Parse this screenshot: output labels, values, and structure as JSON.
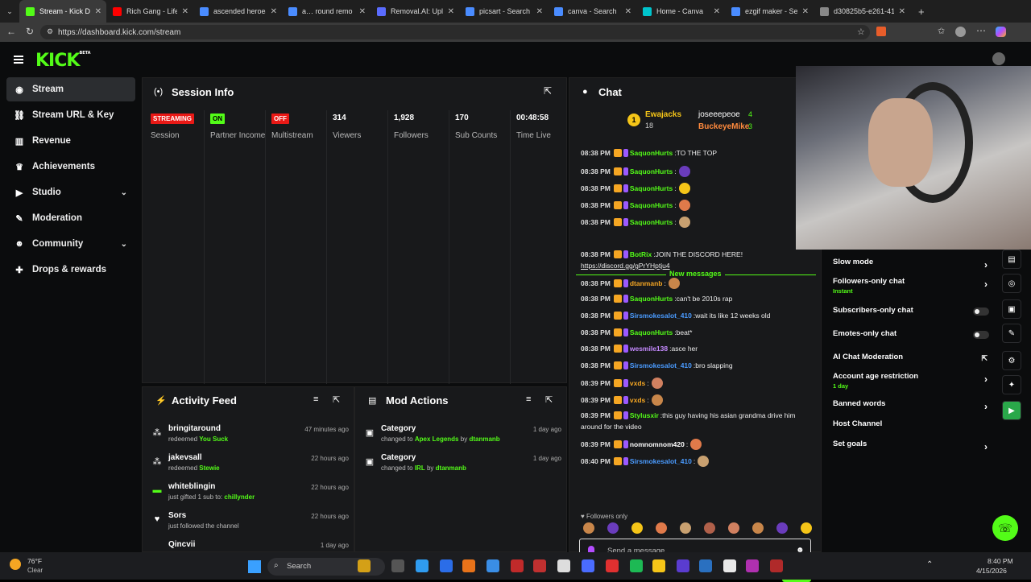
{
  "browser": {
    "tabs": [
      {
        "label": "Stream - Kick Dashb",
        "color": "#53fc18",
        "active": true
      },
      {
        "label": "Rich Gang - Life",
        "color": "#ff0000",
        "active": false
      },
      {
        "label": "ascended heroes log",
        "color": "#4a8cff",
        "active": false
      },
      {
        "label": "a… round remo",
        "color": "#4a8cff",
        "active": false
      },
      {
        "label": "Removal.AI: Upload",
        "color": "#5a6cff",
        "active": false
      },
      {
        "label": "picsart - Search",
        "color": "#4a8cff",
        "active": false
      },
      {
        "label": "canva - Search",
        "color": "#4a8cff",
        "active": false
      },
      {
        "label": "Home - Canva",
        "color": "#00c4cc",
        "active": false
      },
      {
        "label": "ezgif maker - Search",
        "color": "#4a8cff",
        "active": false
      },
      {
        "label": "d30825b5-e261-413",
        "color": "#888888",
        "active": false
      }
    ],
    "url": "https://dashboard.kick.com/stream",
    "new_tab": "+"
  },
  "app": {
    "logo": "KICK",
    "logo_tag": "BETA",
    "accent": "#53fc18"
  },
  "sidebar": {
    "items": [
      {
        "label": "Stream",
        "icon": "broadcast-icon"
      },
      {
        "label": "Stream URL & Key",
        "icon": "link-icon"
      },
      {
        "label": "Revenue",
        "icon": "chart-icon"
      },
      {
        "label": "Achievements",
        "icon": "trophy-icon"
      },
      {
        "label": "Studio",
        "icon": "video-icon"
      },
      {
        "label": "Moderation",
        "icon": "wrench-icon"
      },
      {
        "label": "Community",
        "icon": "users-icon"
      },
      {
        "label": "Drops & rewards",
        "icon": "gift-icon"
      }
    ]
  },
  "session": {
    "title": "Session Info",
    "stats": [
      {
        "badge": "STREAMING",
        "badge_color": "#e91916",
        "label": "Session"
      },
      {
        "badge": "ON",
        "badge_color": "#53fc18",
        "label": "Partner Income"
      },
      {
        "badge": "OFF",
        "badge_color": "#e91916",
        "label": "Multistream"
      },
      {
        "value": "314",
        "label": "Viewers"
      },
      {
        "value": "1,928",
        "label": "Followers"
      },
      {
        "value": "170",
        "label": "Sub Counts"
      },
      {
        "value": "00:48:58",
        "label": "Time Live"
      }
    ]
  },
  "activity": {
    "title": "Activity Feed",
    "items": [
      {
        "name": "bringitaround",
        "text": "redeemed",
        "highlight": "You Suck",
        "time": "47 minutes ago"
      },
      {
        "name": "jakevsall",
        "text": "redeemed",
        "highlight": "Stewie",
        "time": "22 hours ago"
      },
      {
        "name": "whiteblingin",
        "text": "just gifted 1 sub to:",
        "highlight": "chillynder",
        "time": "22 hours ago"
      },
      {
        "name": "Sors",
        "text": "just followed the channel",
        "highlight": "",
        "time": "22 hours ago"
      },
      {
        "name": "Qincvii",
        "text": "",
        "highlight": "",
        "time": "1 day ago"
      }
    ]
  },
  "mod_actions": {
    "title": "Mod Actions",
    "items": [
      {
        "name": "Category",
        "text": "changed to",
        "value": "Apex Legends",
        "by": "by",
        "mod": "dtanmanb",
        "time": "1 day ago"
      },
      {
        "name": "Category",
        "text": "changed to",
        "value": "IRL",
        "by": "by",
        "mod": "dtanmanb",
        "time": "1 day ago"
      }
    ]
  },
  "chat": {
    "title": "Chat",
    "top_gifters": [
      {
        "rank": "1",
        "name": "Ewajacks",
        "count": "18"
      },
      {
        "name": "joseeepeoe",
        "count": "4"
      },
      {
        "name": "BuckeyeMike",
        "count": "3"
      }
    ],
    "new_messages_label": "New messages",
    "messages": [
      {
        "time": "08:38 PM",
        "user": "SaquonHurts",
        "color": "#53fc18",
        "text": "TO THE TOP"
      },
      {
        "time": "08:38 PM",
        "user": "SaquonHurts",
        "color": "#53fc18",
        "text": ""
      },
      {
        "time": "08:38 PM",
        "user": "SaquonHurts",
        "color": "#53fc18",
        "text": ""
      },
      {
        "time": "08:38 PM",
        "user": "SaquonHurts",
        "color": "#53fc18",
        "text": ""
      },
      {
        "time": "08:38 PM",
        "user": "SaquonHurts",
        "color": "#53fc18",
        "text": ""
      },
      {
        "time": "08:38 PM",
        "user": "BotRix",
        "color": "#53fc18",
        "text": "JOIN THE DISCORD HERE!"
      },
      {
        "time": "",
        "user": "",
        "color": "#ffffff",
        "text": "https://discord.gg/gPrYHptju4"
      },
      {
        "time": "08:38 PM",
        "user": "dtanmanb",
        "color": "#f5a623",
        "text": ""
      },
      {
        "time": "08:38 PM",
        "user": "SaquonHurts",
        "color": "#53fc18",
        "text": "can't be 2010s rap"
      },
      {
        "time": "08:38 PM",
        "user": "Sirsmokesalot_410",
        "color": "#4a9bff",
        "text": "wait its like 12 weeks old"
      },
      {
        "time": "08:38 PM",
        "user": "SaquonHurts",
        "color": "#53fc18",
        "text": "beat*"
      },
      {
        "time": "08:38 PM",
        "user": "wesmile138",
        "color": "#c58aff",
        "text": "asce her"
      },
      {
        "time": "08:38 PM",
        "user": "Sirsmokesalot_410",
        "color": "#4a9bff",
        "text": "bro slapping"
      },
      {
        "time": "08:39 PM",
        "user": "vxds",
        "color": "#f5a623",
        "text": ""
      },
      {
        "time": "08:39 PM",
        "user": "vxds",
        "color": "#f5a623",
        "text": ""
      },
      {
        "time": "08:39 PM",
        "user": "Stylusxir",
        "color": "#53fc18",
        "text": "this guy having his asian grandma drive him"
      },
      {
        "time": "",
        "user": "",
        "color": "#ffffff",
        "text": "around for the video"
      },
      {
        "time": "08:39 PM",
        "user": "nomnomnom420",
        "color": "#ffffff",
        "text": ""
      },
      {
        "time": "08:40 PM",
        "user": "Sirsmokesalot_410",
        "color": "#4a9bff",
        "text": ""
      }
    ],
    "followers_only_label": "Followers only",
    "input_placeholder": "Send a message",
    "viewer_count": "65",
    "send_label": "Chat"
  },
  "chat_settings": {
    "items": [
      {
        "label": "Slow mode",
        "sub": "",
        "control": "arrow"
      },
      {
        "label": "Followers-only chat",
        "sub": "Instant",
        "control": "arrow"
      },
      {
        "label": "Subscribers-only chat",
        "sub": "",
        "control": "toggle"
      },
      {
        "label": "Emotes-only chat",
        "sub": "",
        "control": "toggle"
      },
      {
        "label": "AI Chat Moderation",
        "sub": "",
        "control": "external"
      },
      {
        "label": "Account age restriction",
        "sub": "1 day",
        "control": "arrow"
      },
      {
        "label": "Banned words",
        "sub": "",
        "control": "arrow"
      },
      {
        "label": "Host Channel",
        "sub": "",
        "control": "none"
      },
      {
        "label": "Set goals",
        "sub": "",
        "control": "arrow"
      }
    ]
  },
  "taskbar": {
    "weather_temp": "76°F",
    "weather_desc": "Clear",
    "search_label": "Search",
    "time": "8:40 PM",
    "date": "4/15/2026"
  }
}
